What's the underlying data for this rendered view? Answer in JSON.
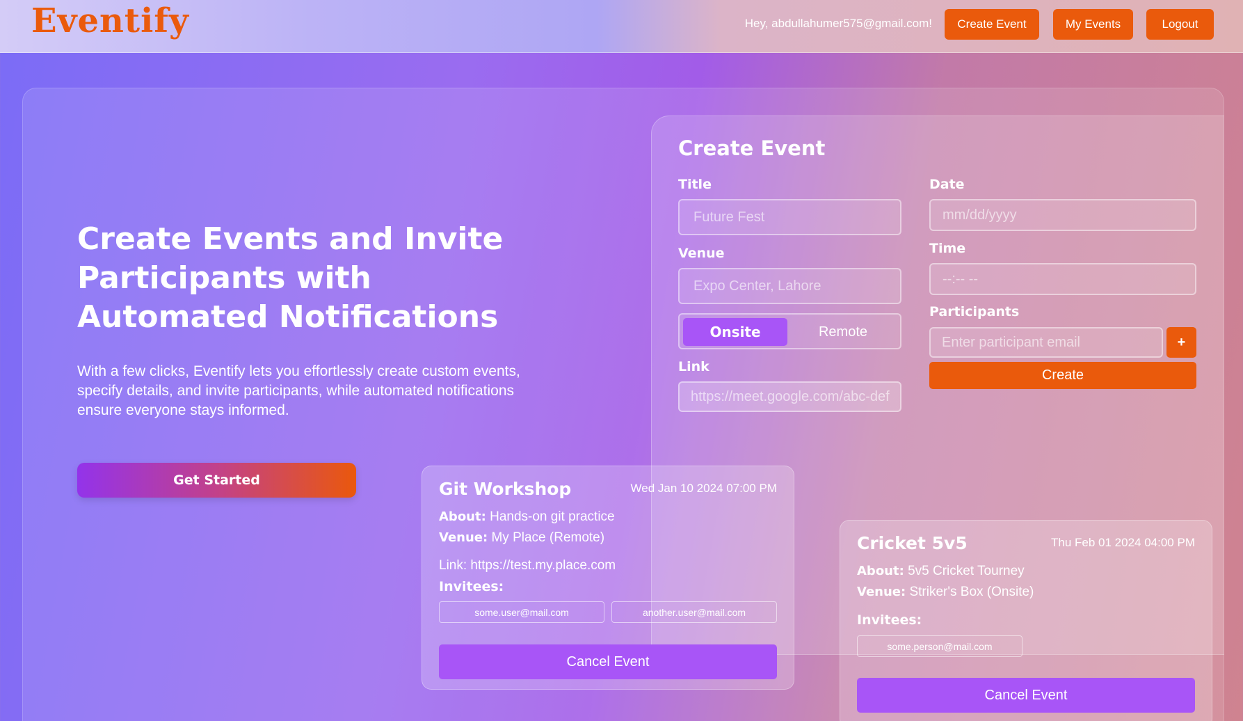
{
  "navbar": {
    "logo": "Eventify",
    "greeting": "Hey, abdullahumer575@gmail.com!",
    "create_event": "Create Event",
    "my_events": "My Events",
    "logout": "Logout"
  },
  "hero": {
    "title": "Create Events and Invite Participants with Automated Notifications",
    "description": "With a few clicks, Eventify lets you effortlessly create custom events, specify details, and invite participants, while automated notifications ensure everyone stays informed.",
    "cta": "Get Started"
  },
  "form": {
    "heading": "Create Event",
    "title_label": "Title",
    "title_placeholder": "Future Fest",
    "venue_label": "Venue",
    "venue_placeholder": "Expo Center, Lahore",
    "mode_onsite": "Onsite",
    "mode_remote": "Remote",
    "mode_selected": "Onsite",
    "link_label": "Link",
    "link_placeholder": "https://meet.google.com/abc-def",
    "date_label": "Date",
    "date_placeholder": "mm/dd/yyyy",
    "time_label": "Time",
    "time_placeholder": "--:-- --",
    "participants_label": "Participants",
    "participants_placeholder": "Enter participant email",
    "add_label": "+",
    "submit": "Create"
  },
  "events": [
    {
      "title": "Git Workshop",
      "date": "Wed Jan 10 2024 07:00 PM",
      "about_label": "About:",
      "about": "Hands-on git practice",
      "venue_label": "Venue:",
      "venue": "My Place (Remote)",
      "link_line": "Link: https://test.my.place.com",
      "invitees_label": "Invitees:",
      "invitees": [
        "some.user@mail.com",
        "another.user@mail.com"
      ],
      "cancel": "Cancel Event"
    },
    {
      "title": "Cricket 5v5",
      "date": "Thu Feb 01 2024 04:00 PM",
      "about_label": "About:",
      "about": "5v5 Cricket Tourney",
      "venue_label": "Venue:",
      "venue": "Striker's Box (Onsite)",
      "invitees_label": "Invitees:",
      "invitees": [
        "some.person@mail.com"
      ],
      "cancel": "Cancel Event"
    }
  ],
  "colors": {
    "accent_orange": "#ea5a0c",
    "accent_purple": "#a855f7"
  }
}
